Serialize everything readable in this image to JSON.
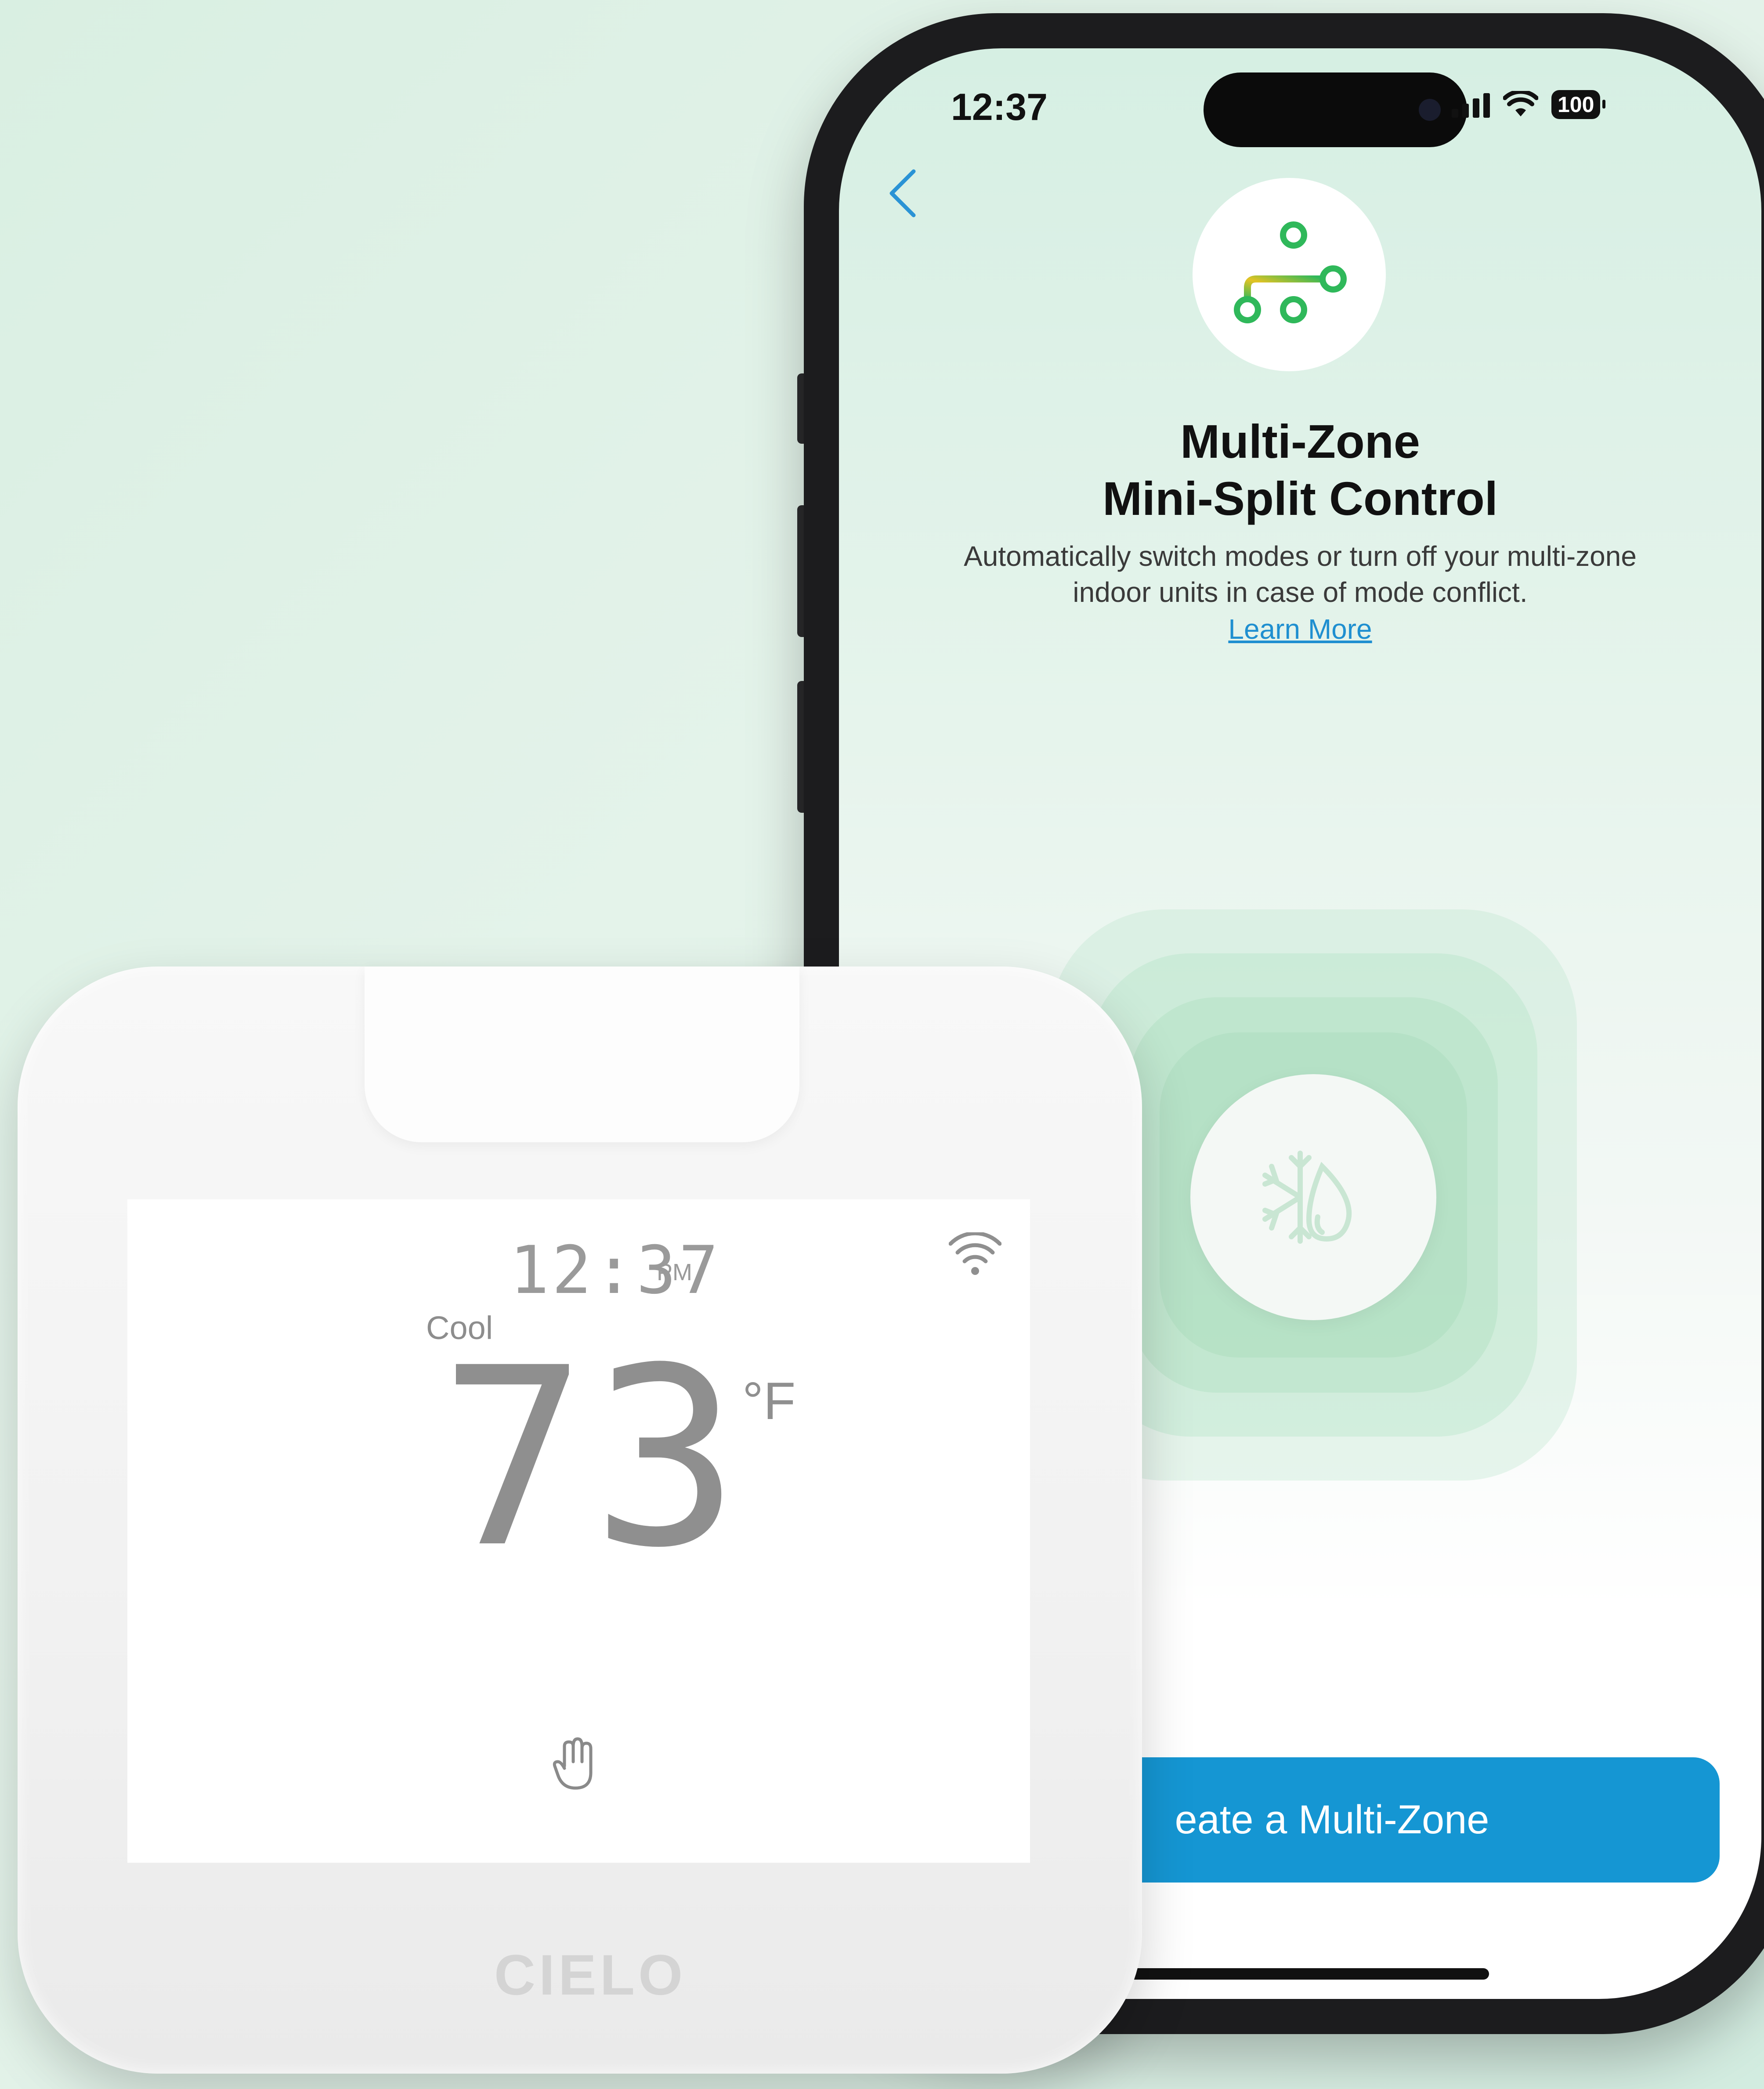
{
  "phone": {
    "status_bar": {
      "time": "12:37",
      "battery": "100"
    },
    "nav": {
      "back_icon": "chevron-left-icon"
    },
    "feature": {
      "icon": "multi-zone-branch-icon",
      "title_line1": "Multi-Zone",
      "title_line2": "Mini-Split Control",
      "description": "Automatically switch modes or turn off your multi-zone indoor units in case of mode conflict.",
      "learn_more": "Learn More"
    },
    "mode_icon": "cool-dry-mode-icon",
    "primary_button": "eate a Multi-Zone",
    "colors": {
      "accent": "#1596d3",
      "link": "#1f8fd0"
    }
  },
  "thermostat": {
    "time": "12:37",
    "ampm": "PM",
    "mode": "Cool",
    "temperature": "73",
    "unit": "°F",
    "wifi_icon": "wifi-icon",
    "hand_icon": "hand-icon",
    "brand": "CIELO"
  }
}
